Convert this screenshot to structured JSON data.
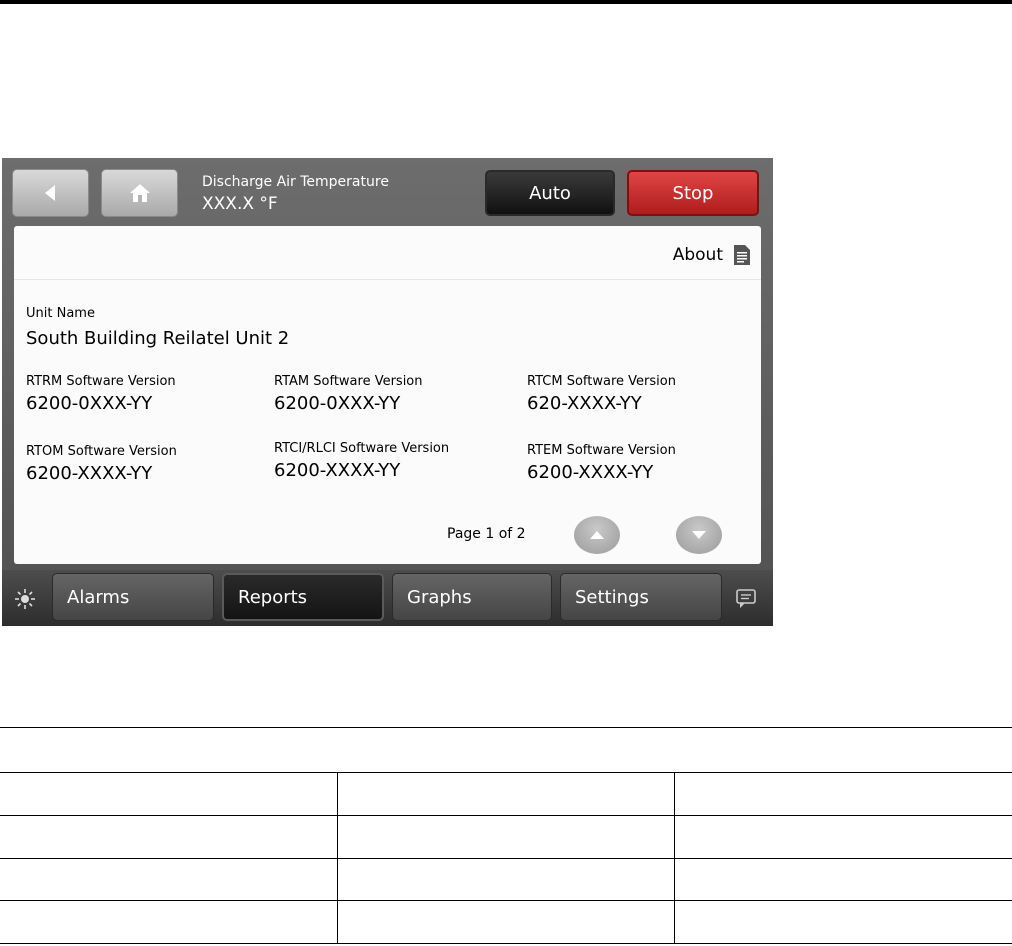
{
  "status": {
    "temp_label": "Discharge Air Temperature",
    "temp_value": "XXX.X °F",
    "auto_label": "Auto",
    "stop_label": "Stop"
  },
  "about": {
    "label": "About"
  },
  "unit": {
    "label": "Unit Name",
    "value": "South Building Reilatel Unit 2"
  },
  "versions": [
    {
      "label": "RTRM Software Version",
      "value": "6200-0XXX-YY"
    },
    {
      "label": "RTAM Software Version",
      "value": "6200-0XXX-YY"
    },
    {
      "label": "RTCM Software Version",
      "value": "620-XXXX-YY"
    },
    {
      "label": "RTOM Software Version",
      "value": "6200-XXXX-YY"
    },
    {
      "label": "RTCI/RLCI Software Version",
      "value": "6200-XXXX-YY"
    },
    {
      "label": "RTEM Software Version",
      "value": "6200-XXXX-YY"
    }
  ],
  "pager": {
    "text": "Page 1 of 2"
  },
  "tabs": [
    {
      "label": "Alarms"
    },
    {
      "label": "Reports"
    },
    {
      "label": "Graphs"
    },
    {
      "label": "Settings"
    }
  ],
  "icons": {
    "back": "back-arrow-icon",
    "home": "home-icon",
    "about": "document-icon",
    "up": "chevron-up-icon",
    "down": "chevron-down-icon",
    "brightness": "sun-icon",
    "chat": "chat-icon"
  },
  "colors": {
    "stop": "#c62828",
    "auto": "#1a1a1a",
    "frame": "#5a5a5a"
  }
}
